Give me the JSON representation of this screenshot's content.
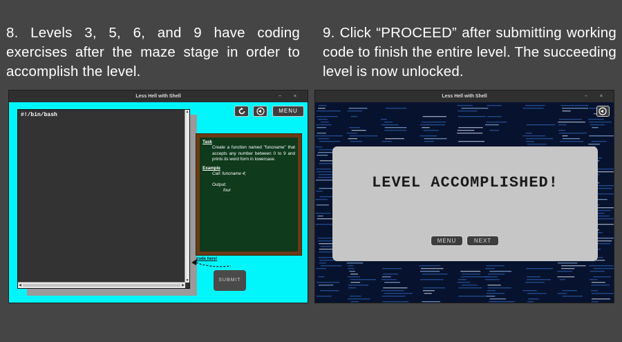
{
  "captions": {
    "left": "8. Levels 3, 5, 6, and 9 have coding exercises after the maze stage in order to accomplish the level.",
    "right": "9. Click “PROCEED” after submitting working code to finish the entire level. The succeeding level is now unlocked."
  },
  "left_window": {
    "title": "Less Hell with Shell",
    "window_controls": "– ×",
    "editor_text": "#!/bin/bash",
    "buttons": {
      "restart_icon": "restart-icon",
      "sound_icon": "sound-icon",
      "menu": "MENU",
      "submit": "SUBMIT"
    },
    "board": {
      "task_heading": "Task",
      "task_text": "Create a function named \"funcname\" that accepts any number between 0 to 9 and prints its word form in lowercase.",
      "example_heading": "Example",
      "call": "Call: funcname 4;",
      "output_label": "Output:",
      "output_value": "four"
    },
    "code_hint": "code here!"
  },
  "right_window": {
    "title": "Less Hell with Shell",
    "window_controls": "– ×",
    "modal_title": "LEVEL ACCOMPLISHED!",
    "buttons": {
      "menu": "MENU",
      "next": "NEXT",
      "sound_icon": "sound-icon"
    }
  },
  "colors": {
    "background": "#454545",
    "cyan": "#00f6fb",
    "board_green": "#0f3a1b",
    "board_frame": "#6b3a14",
    "modal": "#c6c6c6"
  }
}
